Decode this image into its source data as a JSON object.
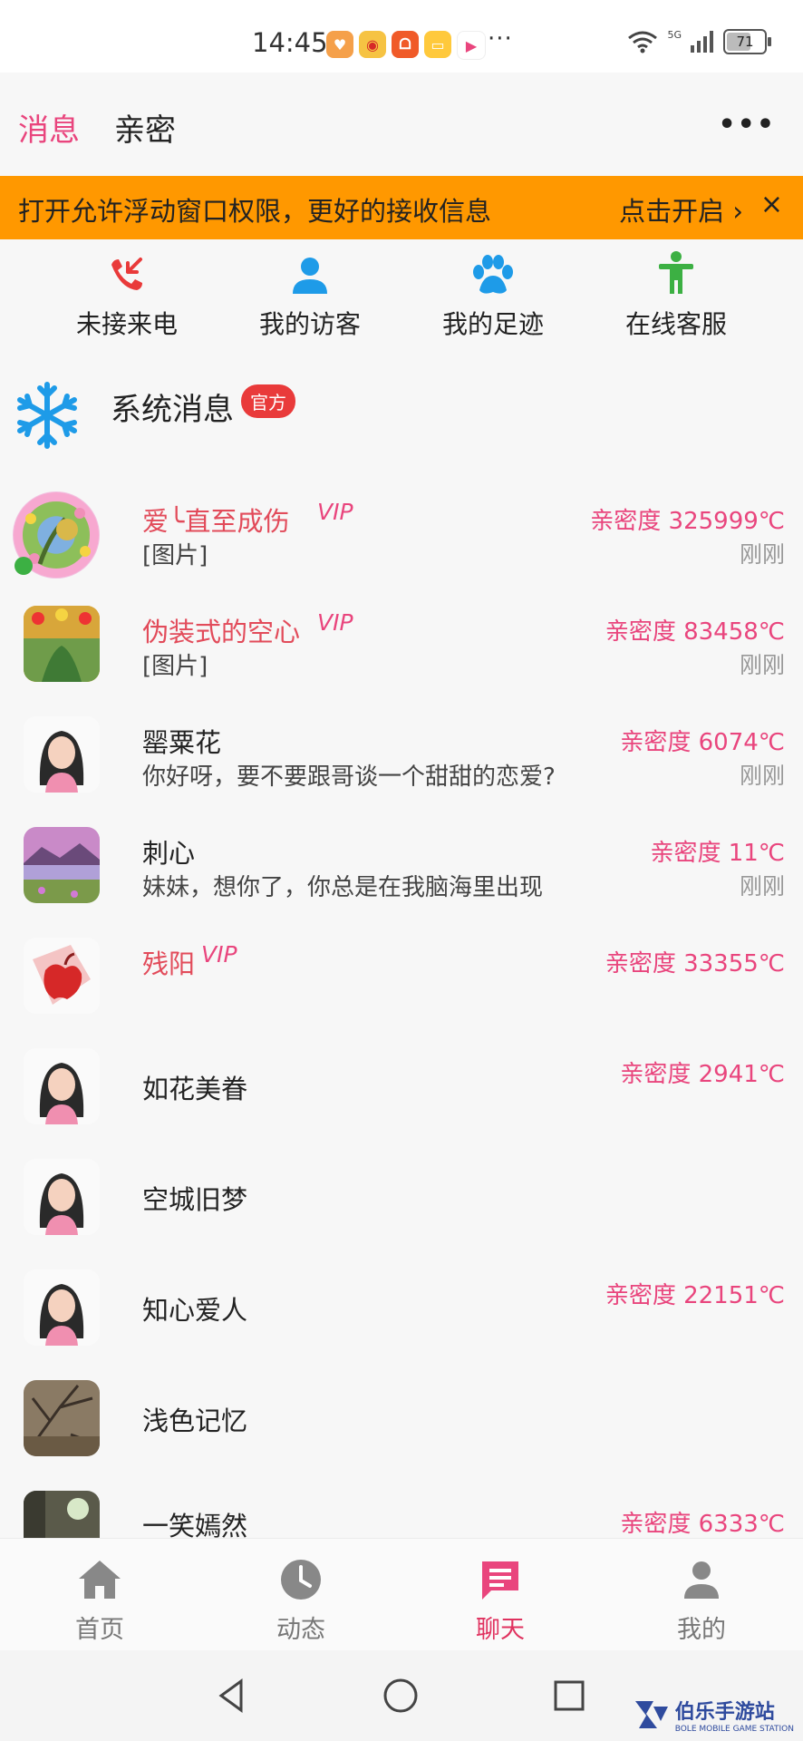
{
  "status_bar": {
    "time": "14:45",
    "more": "···",
    "signal": "5G",
    "battery": "71",
    "battery_level": 0.71
  },
  "top": {
    "tabs": [
      {
        "label": "消息",
        "active": true
      },
      {
        "label": "亲密",
        "active": false
      }
    ],
    "more": "•••"
  },
  "banner": {
    "message": "打开允许浮动窗口权限，更好的接收信息",
    "action": "点击开启 ›",
    "close": "×"
  },
  "quick_actions": [
    {
      "label": "未接来电",
      "icon": "missed-call-icon"
    },
    {
      "label": "我的访客",
      "icon": "person-icon"
    },
    {
      "label": "我的足迹",
      "icon": "paw-icon"
    },
    {
      "label": "在线客服",
      "icon": "service-icon"
    }
  ],
  "system_message": {
    "title": "系统消息",
    "badge": "官方"
  },
  "conversations": [
    {
      "name": "爱╰直至成伤",
      "vip": "VIP",
      "preview": "[图片]",
      "intimacy": "亲密度 325999℃",
      "time": "刚刚",
      "avatar": "avatar-floral-wreath"
    },
    {
      "name": "伪装式的空心",
      "vip": "VIP",
      "preview": "[图片]",
      "intimacy": "亲密度 83458℃",
      "time": "刚刚",
      "avatar": "avatar-flowers"
    },
    {
      "name": "罂粟花",
      "vip": "",
      "preview": "你好呀，要不要跟哥谈一个甜甜的恋爱?",
      "intimacy": "亲密度 6074℃",
      "time": "刚刚",
      "avatar": "avatar-girl"
    },
    {
      "name": "刺心",
      "vip": "",
      "preview": "妹妹，想你了，你总是在我脑海里出现",
      "intimacy": "亲密度 11℃",
      "time": "刚刚",
      "avatar": "avatar-landscape"
    },
    {
      "name": "残阳",
      "vip": "VIP",
      "preview": "",
      "intimacy": "亲密度 33355℃",
      "time": "",
      "avatar": "avatar-red-apple"
    },
    {
      "name": "如花美眷",
      "vip": "",
      "preview": "",
      "intimacy": "亲密度 2941℃",
      "time": "",
      "avatar": "avatar-girl"
    },
    {
      "name": "空城旧梦",
      "vip": "",
      "preview": "",
      "intimacy": "",
      "time": "",
      "avatar": "avatar-girl"
    },
    {
      "name": "知心爱人",
      "vip": "",
      "preview": "",
      "intimacy": "亲密度 22151℃",
      "time": "",
      "avatar": "avatar-girl"
    },
    {
      "name": "浅色记忆",
      "vip": "",
      "preview": "",
      "intimacy": "",
      "time": "",
      "avatar": "avatar-branches"
    },
    {
      "name": "一笑嫣然",
      "vip": "",
      "preview": "",
      "intimacy": "亲密度 6333℃",
      "time": "",
      "avatar": "avatar-photo"
    }
  ],
  "bottom_nav": [
    {
      "label": "首页",
      "icon": "home-icon",
      "active": false
    },
    {
      "label": "动态",
      "icon": "clock-icon",
      "active": false
    },
    {
      "label": "聊天",
      "icon": "chat-icon",
      "active": true
    },
    {
      "label": "我的",
      "icon": "profile-icon",
      "active": false
    }
  ],
  "watermark": {
    "title": "伯乐手游站",
    "subtitle": "BOLE MOBILE GAME STATION"
  },
  "colors": {
    "accent": "#e9457d",
    "banner": "#ff9800",
    "vip_name": "#e24b5a",
    "nav_active": "#e0325f",
    "service_green": "#3cb043",
    "info_blue": "#1e9be8"
  }
}
